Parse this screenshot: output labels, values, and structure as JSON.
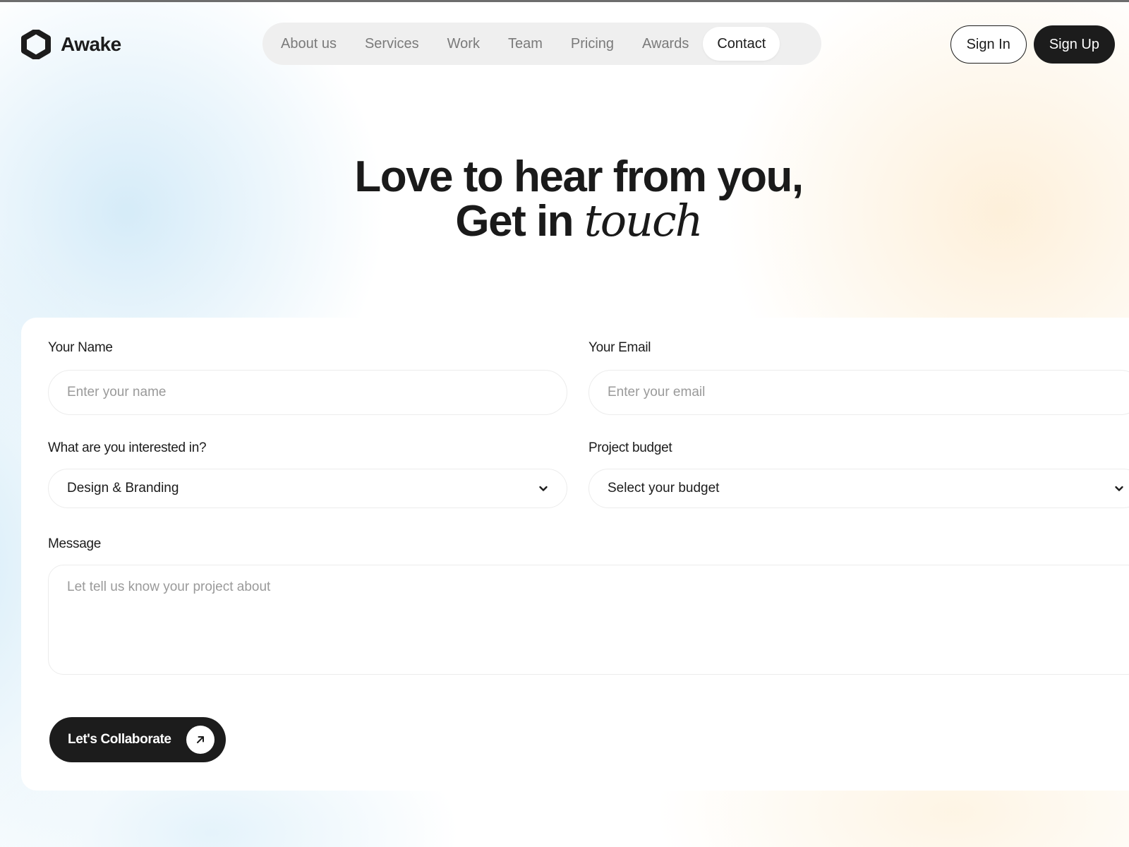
{
  "brand": {
    "name": "Awake",
    "logo_icon": "hexagon-logo-icon"
  },
  "nav": {
    "items": [
      {
        "label": "About us",
        "active": false
      },
      {
        "label": "Services",
        "active": false
      },
      {
        "label": "Work",
        "active": false
      },
      {
        "label": "Team",
        "active": false
      },
      {
        "label": "Pricing",
        "active": false
      },
      {
        "label": "Awards",
        "active": false
      },
      {
        "label": "Contact",
        "active": true
      }
    ]
  },
  "auth": {
    "sign_in_label": "Sign In",
    "sign_up_label": "Sign Up"
  },
  "hero": {
    "line1": "Love to hear from you,",
    "line2_prefix": "Get in ",
    "line2_emphasis": "touch"
  },
  "form": {
    "name": {
      "label": "Your Name",
      "placeholder": "Enter your name",
      "value": ""
    },
    "email": {
      "label": "Your Email",
      "placeholder": "Enter your email",
      "value": ""
    },
    "interest": {
      "label": "What are you interested in?",
      "selected": "Design & Branding",
      "icon": "chevron-down-icon"
    },
    "budget": {
      "label": "Project budget",
      "selected": "Select your budget",
      "icon": "chevron-down-icon"
    },
    "message": {
      "label": "Message",
      "placeholder": "Let tell us know your project about",
      "value": ""
    },
    "submit": {
      "label": "Let's Collaborate",
      "icon": "arrow-up-right-icon"
    }
  },
  "colors": {
    "primary_dark": "#1c1c1c",
    "nav_bg": "#efefef",
    "muted_text": "#7a7a7a",
    "placeholder": "#9a9a9a",
    "border": "#ececec"
  }
}
